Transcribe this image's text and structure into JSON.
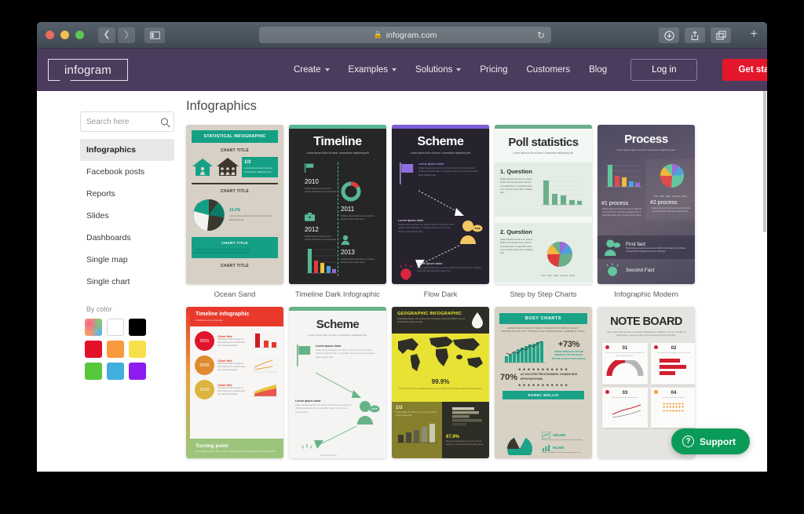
{
  "browser": {
    "url": "infogram.com",
    "lock_icon": "lock-icon",
    "reload_icon": "reload-icon",
    "back_icon": "chevron-left-icon",
    "forward_icon": "chevron-right-icon",
    "sidebar_icon": "sidebar-toggle-icon",
    "download_icon": "download-icon",
    "share_icon": "share-icon",
    "tabs_icon": "tab-overview-icon",
    "newtab_label": "+",
    "traffic_lights": [
      "close",
      "minimize",
      "zoom"
    ]
  },
  "site_header": {
    "logo_text": "infogram",
    "brand_bg": "#4b3c5e",
    "nav": [
      {
        "label": "Create",
        "has_caret": true
      },
      {
        "label": "Examples",
        "has_caret": true
      },
      {
        "label": "Solutions",
        "has_caret": true
      },
      {
        "label": "Pricing",
        "has_caret": false
      },
      {
        "label": "Customers",
        "has_caret": false
      },
      {
        "label": "Blog",
        "has_caret": false
      }
    ],
    "login_label": "Log in",
    "get_started_label": "Get started",
    "get_started_color": "#e4162b"
  },
  "sidebar": {
    "search": {
      "placeholder": "Search here",
      "value": ""
    },
    "items": [
      {
        "label": "Infographics",
        "active": true
      },
      {
        "label": "Facebook posts",
        "active": false
      },
      {
        "label": "Reports",
        "active": false
      },
      {
        "label": "Slides",
        "active": false
      },
      {
        "label": "Dashboards",
        "active": false
      },
      {
        "label": "Single map",
        "active": false
      },
      {
        "label": "Single chart",
        "active": false
      }
    ],
    "by_color_label": "By color",
    "colors": [
      {
        "name": "multicolor",
        "hex": "rainbow"
      },
      {
        "name": "white",
        "hex": "#ffffff"
      },
      {
        "name": "black",
        "hex": "#000000"
      },
      {
        "name": "red",
        "hex": "#e3112a"
      },
      {
        "name": "orange",
        "hex": "#f89b3e"
      },
      {
        "name": "yellow",
        "hex": "#f7e04a"
      },
      {
        "name": "green",
        "hex": "#55c93b"
      },
      {
        "name": "blue",
        "hex": "#41aee0"
      },
      {
        "name": "purple",
        "hex": "#8e1cf0"
      }
    ]
  },
  "main": {
    "title": "Infographics",
    "templates": [
      {
        "caption": "Ocean Sand",
        "bg": "#d7d0c5",
        "accent": "#14a085",
        "dark": "#3b372f",
        "header": "STATISTICAL INFOGRAPHIC",
        "chart_titles": [
          "CHART TITLE",
          "CHART TITLE",
          "CHART TITLE",
          "CHART TITLE"
        ],
        "stat": "1/3",
        "pie_label": "16.2%",
        "body": "Lorem ipsum dolor sit amet, consectetur adipiscing elit."
      },
      {
        "caption": "Timeline Dark Infographic",
        "bg": "#262626",
        "accent": "#57b894",
        "title": "Timeline",
        "subtitle": "Lorem ipsum dolor sit amet, consectetur adipiscing elit",
        "years": [
          "2010",
          "2011",
          "2012",
          "2013"
        ],
        "body": "Nullam laoreet sed arcu eu viverra. Morbi id commodo tortor."
      },
      {
        "caption": "Flow Dark",
        "bg": "#26222e",
        "accent": "#7b5fd6",
        "accent2": "#f2c661",
        "accent3": "#d8263f",
        "title": "Scheme",
        "subtitle": "Lorem ipsum dolor sit amet, consectetur adipiscing elit.",
        "node_labels": [
          "Lorem ipsum dolor",
          "Lorem ipsum dolor",
          "Lorem ipsum dolor"
        ]
      },
      {
        "caption": "Step by Step Charts",
        "bg": "#eef4ee",
        "accent": "#6aaf89",
        "title": "Poll statistics",
        "subtitle": "Lorem ipsum dolor sit amet, consectetur adipiscing elit.",
        "questions": [
          "1. Question",
          "2. Question"
        ],
        "bar_values": [
          100,
          45,
          38,
          20,
          17
        ],
        "pie_legend": [
          "USA",
          "China",
          "Japan",
          "Germany",
          "France"
        ]
      },
      {
        "caption": "Infographic Modern",
        "bg": "#4a4a5e",
        "accent": "#63c6a0",
        "title": "Process",
        "subtitle": "Lorem ipsum dolor sit amet, consectetur adipiscing elit.",
        "sections": [
          "#1 process",
          "#2 process"
        ],
        "facts": [
          "First fact",
          "Second Fact"
        ],
        "bar_values": [
          100,
          52,
          48,
          26,
          22
        ],
        "pie_legend": [
          "USA",
          "China",
          "Japan",
          "Germany",
          "France"
        ]
      },
      {
        "caption": "",
        "bg": "#f2f2f0",
        "accent": "#e8392b",
        "title": "Timeline infographic",
        "subtitle": "Vestibulum auctor imperdiet",
        "years": [
          "2001",
          "2005",
          "2010"
        ],
        "chart_titles": [
          "Chart title",
          "Chart title",
          "Chart title"
        ],
        "footer": "Turning point",
        "footer_bg": "#9cc47c"
      },
      {
        "caption": "",
        "bg": "#f4f4f2",
        "accent": "#66b388",
        "title": "Scheme",
        "subtitle": "Lorem ipsum dolor sit amet, consectetur adipiscing elit.",
        "node_labels": [
          "Lorem ipsum dolor",
          "Lorem ipsum dolor",
          "Lorem ipsum dolor"
        ]
      },
      {
        "caption": "",
        "bg": "#e8e235",
        "accent": "#2e2e26",
        "title": "GEOGRAPHIC INFOGRAPHIC",
        "subtitle": "Suspendisse finibus, erat at elementum consectetur, turpis justo facilisis velit, sed faucibus libero risus non tellus.",
        "stats": [
          "99.9%",
          "1/3",
          "67.9%"
        ],
        "note": "Donec sit amet ex vel velit aliquet maximus. Nunc rhoncus turpis ac justo consectetur condimentum."
      },
      {
        "caption": "",
        "bg": "#d8d2c4",
        "accent": "#1aa388",
        "title": "BUSY CHARTS",
        "subtitle": "LOREM IPSUM DOLOR SIT AMET, CONSECTETUR ADIPISCING ELIT. VESTIBULUM NISL NISI, CONVALLIS VEL SCELERISQUE A, SEMPER SIT VELIT.",
        "stats": [
          "+73%",
          "70%",
          "100,000",
          "50,000"
        ],
        "banner": "DONEC MOLLIS",
        "note": "AC VOLUTPAT FELIS EUISMOD. VIVAMUS NON EFFICITUR IPSUM."
      },
      {
        "caption": "",
        "bg": "#e6e4e0",
        "accent": "#cf2030",
        "title": "NOTE BOARD",
        "subtitle": "Lorem ipsum dolor sit amet, consectetur adipiscing elit. Vestibulum nisl nisi, convallis vel scelerisque a, semper sit velit. Morbi consequat dictum bibendum.",
        "numbers": [
          "01",
          "02",
          "03",
          "04"
        ]
      }
    ]
  },
  "support": {
    "label": "Support",
    "icon": "question-circle-icon",
    "color": "#0a9b59"
  }
}
